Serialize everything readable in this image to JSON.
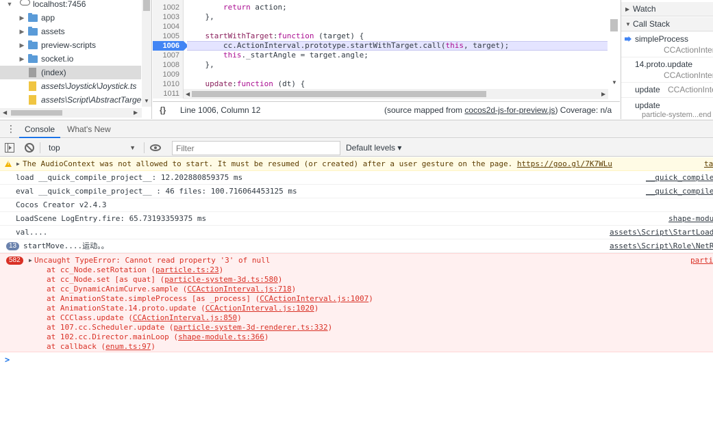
{
  "navigator": {
    "items": [
      {
        "label": "localhost:7456",
        "type": "origin",
        "expanded": true
      },
      {
        "label": "app",
        "type": "folder"
      },
      {
        "label": "assets",
        "type": "folder"
      },
      {
        "label": "preview-scripts",
        "type": "folder"
      },
      {
        "label": "socket.io",
        "type": "folder"
      },
      {
        "label": "(index)",
        "type": "file",
        "selected": true
      },
      {
        "label": "assets\\Joystick\\Joystick.ts",
        "type": "js"
      },
      {
        "label": "assets\\Script\\AbstractTarget",
        "type": "js"
      }
    ]
  },
  "editor": {
    "lines": [
      {
        "num": "1002",
        "code": "        return action;",
        "kw": "return",
        "rest": " action;"
      },
      {
        "num": "1003",
        "code": "    },"
      },
      {
        "num": "1004",
        "code": ""
      },
      {
        "num": "1005",
        "code": "    startWithTarget:function (target) {",
        "prop": "startWithTarget",
        "kw": "function",
        "rest": " (target) {"
      },
      {
        "num": "1006",
        "code": "        cc.ActionInterval.prototype.startWithTarget.call(this, target);",
        "highlighted": true
      },
      {
        "num": "1007",
        "code": "        this._startAngle = target.angle;",
        "kw": "this",
        "rest": "._startAngle = target.angle;"
      },
      {
        "num": "1008",
        "code": "    },"
      },
      {
        "num": "1009",
        "code": ""
      },
      {
        "num": "1010",
        "code": "    update:function (dt) {",
        "prop": "update",
        "kw": "function",
        "rest": " (dt) {"
      },
      {
        "num": "1011",
        "code": ""
      }
    ],
    "status": {
      "braces": "{}",
      "position": "Line 1006, Column 12",
      "mapped_prefix": "(source mapped from ",
      "mapped_link": "cocos2d-js-for-preview.js",
      "mapped_suffix": ")",
      "coverage": "Coverage: n/a"
    }
  },
  "right_pane": {
    "watch_label": "Watch",
    "callstack_label": "Call Stack",
    "frames": [
      {
        "fn": "simpleProcess",
        "file": "CCActionInter",
        "current": true
      },
      {
        "fn": "14.proto.update",
        "file": "CCActionInter"
      },
      {
        "fn": "update",
        "file": "CCActionInte",
        "inline": true
      },
      {
        "fn": "update",
        "file": "particle-system...end"
      }
    ]
  },
  "drawer": {
    "tabs": [
      "Console",
      "What's New"
    ],
    "active_tab": "Console"
  },
  "console_toolbar": {
    "context": "top",
    "filter_placeholder": "Filter",
    "filter_value": "",
    "levels": "Default levels ▾"
  },
  "messages": [
    {
      "level": "warning",
      "text": "The AudioContext was not allowed to start. It must be resumed (or created) after a user gesture on the page. ",
      "link": "https://goo.gl/7K7WLu",
      "source": "ta"
    },
    {
      "level": "log",
      "text": "load __quick_compile_project__: 12.202880859375 ms",
      "source": "__quick_compile"
    },
    {
      "level": "log",
      "text": "eval __quick_compile_project__ : 46 files: 100.716064453125 ms",
      "source": "__quick_compile"
    },
    {
      "level": "log",
      "text": "Cocos Creator v2.4.3",
      "source": ""
    },
    {
      "level": "log",
      "text": "LoadScene LogEntry.fire: 65.73193359375 ms",
      "source": "shape-modu"
    },
    {
      "level": "log",
      "text": "val....",
      "source": "assets\\Script\\StartLoad"
    },
    {
      "level": "log",
      "count": "13",
      "text": "startMove....运动。。",
      "source": "assets\\Script\\Role\\NetR"
    }
  ],
  "error": {
    "count": "582",
    "message": "Uncaught TypeError: Cannot read property '3' of null",
    "source": "parti",
    "stack": [
      {
        "at": "at cc_Node.setRotation (",
        "loc": "particle.ts:23",
        "end": ")"
      },
      {
        "at": "at cc_Node.set [as quat] (",
        "loc": "particle-system-3d.ts:580",
        "end": ")"
      },
      {
        "at": "at cc_DynamicAnimCurve.sample (",
        "loc": "CCActionInterval.js:718",
        "end": ")"
      },
      {
        "at": "at AnimationState.simpleProcess [as _process] (",
        "loc": "CCActionInterval.js:1007",
        "end": ")"
      },
      {
        "at": "at AnimationState.14.proto.update (",
        "loc": "CCActionInterval.js:1020",
        "end": ")"
      },
      {
        "at": "at CCClass.update (",
        "loc": "CCActionInterval.js:850",
        "end": ")"
      },
      {
        "at": "at 107.cc.Scheduler.update (",
        "loc": "particle-system-3d-renderer.ts:332",
        "end": ")"
      },
      {
        "at": "at 102.cc.Director.mainLoop (",
        "loc": "shape-module.ts:366",
        "end": ")"
      },
      {
        "at": "at callback (",
        "loc": "enum.ts:97",
        "end": ")"
      }
    ]
  },
  "prompt": ">",
  "colors": {
    "accent": "#1a73e8",
    "breakpoint": "#4285f4",
    "error_text": "#d93025",
    "error_bg": "#fff0f0",
    "warning_bg": "#fffbe5"
  }
}
